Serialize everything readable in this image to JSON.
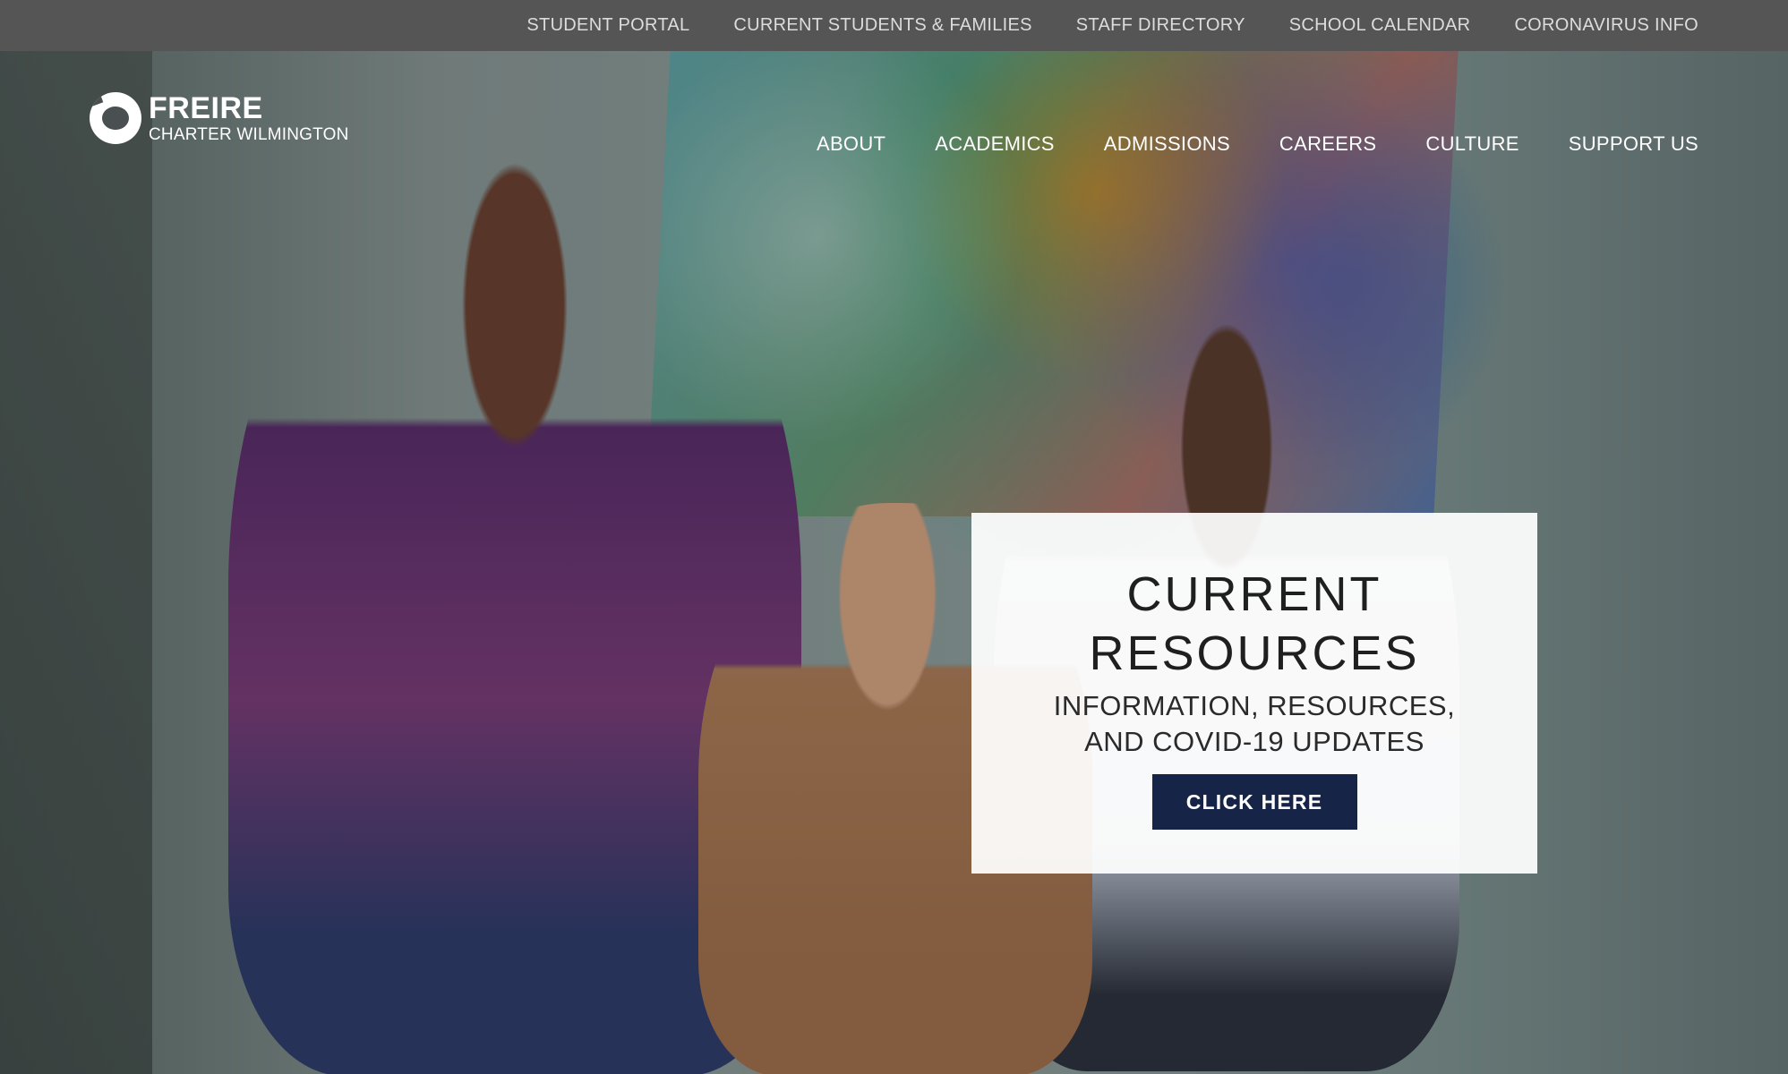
{
  "utility_nav": {
    "items": [
      {
        "label": "STUDENT PORTAL"
      },
      {
        "label": "CURRENT STUDENTS & FAMILIES"
      },
      {
        "label": "STAFF DIRECTORY"
      },
      {
        "label": "SCHOOL CALENDAR"
      },
      {
        "label": "CORONAVIRUS INFO"
      }
    ]
  },
  "logo": {
    "name": "FREIRE",
    "subtitle": "CHARTER WILMINGTON",
    "icon": "freire-logo-icon"
  },
  "main_nav": {
    "items": [
      {
        "label": "ABOUT"
      },
      {
        "label": "ACADEMICS"
      },
      {
        "label": "ADMISSIONS"
      },
      {
        "label": "CAREERS"
      },
      {
        "label": "CULTURE"
      },
      {
        "label": "SUPPORT US"
      }
    ]
  },
  "callout": {
    "title_line1": "CURRENT",
    "title_line2": "RESOURCES",
    "subtitle_line1": "INFORMATION, RESOURCES,",
    "subtitle_line2": "AND COVID-19 UPDATES",
    "button_label": "CLICK HERE"
  },
  "colors": {
    "utility_bar": "#555555",
    "button": "#162447",
    "card": "#ffffff"
  }
}
